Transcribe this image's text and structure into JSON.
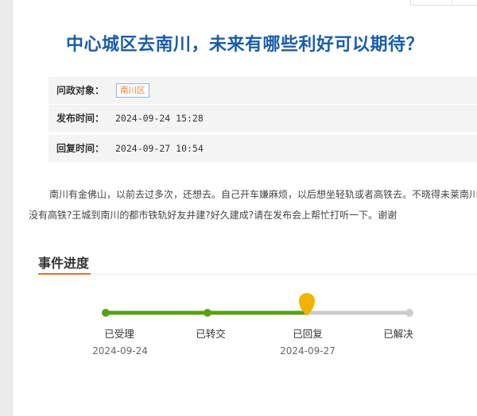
{
  "article": {
    "title": "中心城区去南川，未来有哪些利好可以期待？"
  },
  "info": {
    "target_label": "问政对象：",
    "target_value": "南川区",
    "publish_label": "发布时间：",
    "publish_value": "2024-09-24 15:28",
    "reply_label": "回复时间：",
    "reply_value": "2024-09-27 10:54"
  },
  "content": {
    "line1": "南川有金佛山，以前去过多次，还想去。自己开车嫌麻烦，以后想坐轻轨或者高铁去。不晓得未莱南川有",
    "line2": "没有高铁?王城到南川的都市铁轨好友井建?好久建成?请在发布会上帮忙打听一下。谢谢"
  },
  "progress": {
    "section_title": "事件进度",
    "steps": [
      {
        "label": "已受理",
        "date": "2024-09-24",
        "done": true
      },
      {
        "label": "已转交",
        "date": "",
        "done": true
      },
      {
        "label": "已回复",
        "date": "2024-09-27",
        "done": true,
        "current": true
      },
      {
        "label": "已解决",
        "date": "",
        "done": false
      }
    ],
    "colors": {
      "done": "#5aa014",
      "pending": "#cccccc",
      "marker": "#f0b400"
    }
  }
}
